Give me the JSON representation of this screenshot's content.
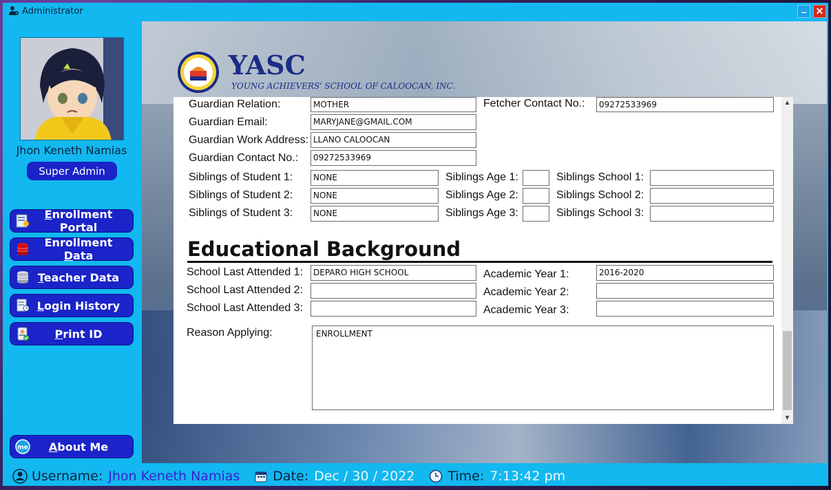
{
  "window": {
    "title": "Administrator",
    "minimize_label": "–",
    "close_label": "✕"
  },
  "sidebar": {
    "user_name": "Jhon Keneth Namias",
    "role": "Super Admin",
    "items": [
      {
        "label_pre": "",
        "label_u": "E",
        "label_post": "nrollment Portal",
        "icon": "enrollment-portal-icon"
      },
      {
        "label_pre": "Enrollment ",
        "label_u": "D",
        "label_post": "ata",
        "icon": "database-red-icon"
      },
      {
        "label_pre": "",
        "label_u": "T",
        "label_post": "eacher Data",
        "icon": "database-gray-icon"
      },
      {
        "label_pre": "",
        "label_u": "L",
        "label_post": "ogin History",
        "icon": "history-icon"
      },
      {
        "label_pre": "",
        "label_u": "P",
        "label_post": "rint ID",
        "icon": "print-id-icon"
      }
    ],
    "about": {
      "label_pre": "",
      "label_u": "A",
      "label_post": "bout Me",
      "icon_text": "me"
    }
  },
  "header": {
    "logo_title": "YASC",
    "logo_subtitle": "YOUNG ACHIEVERS' SCHOOL OF CALOOCAN, INC."
  },
  "guardian": {
    "relation_label": "Guardian Relation:",
    "relation_value": "MOTHER",
    "fetcher_contact_label": "Fetcher Contact No.:",
    "fetcher_contact_value": "09272533969",
    "email_label": "Guardian Email:",
    "email_value": "MARYJANE@GMAIL.COM",
    "work_address_label": "Guardian Work Address:",
    "work_address_value": "LLANO CALOOCAN",
    "contact_label": "Guardian Contact No.:",
    "contact_value": "09272533969"
  },
  "siblings": [
    {
      "name_label": "Siblings of Student 1:",
      "name_value": "NONE",
      "age_label": "Siblings Age 1:",
      "age_value": "",
      "school_label": "Siblings School 1:",
      "school_value": ""
    },
    {
      "name_label": "Siblings of Student 2:",
      "name_value": "NONE",
      "age_label": "Siblings Age 2:",
      "age_value": "",
      "school_label": "Siblings School 2:",
      "school_value": ""
    },
    {
      "name_label": "Siblings of Student 3:",
      "name_value": "NONE",
      "age_label": "Siblings Age 3:",
      "age_value": "",
      "school_label": "Siblings School 3:",
      "school_value": ""
    }
  ],
  "education": {
    "section_title": "Educational Background",
    "rows": [
      {
        "school_label": "School Last Attended 1:",
        "school_value": "DEPARO HIGH SCHOOL",
        "year_label": "Academic Year 1:",
        "year_value": "2016-2020"
      },
      {
        "school_label": "School Last Attended 2:",
        "school_value": "",
        "year_label": "Academic Year 2:",
        "year_value": ""
      },
      {
        "school_label": "School Last Attended 3:",
        "school_value": "",
        "year_label": "Academic Year 3:",
        "year_value": ""
      }
    ],
    "reason_label": "Reason Applying:",
    "reason_value": "ENROLLMENT"
  },
  "statusbar": {
    "username_label": "Username:",
    "username_value": "Jhon Keneth Namias",
    "date_label": "Date:",
    "date_value": "Dec / 30 / 2022",
    "time_label": "Time:",
    "time_value": "7:13:42 pm"
  },
  "colors": {
    "window_bg": "#12b8ef",
    "nav_button": "#1a24c8",
    "brand_blue": "#1b2c86"
  }
}
